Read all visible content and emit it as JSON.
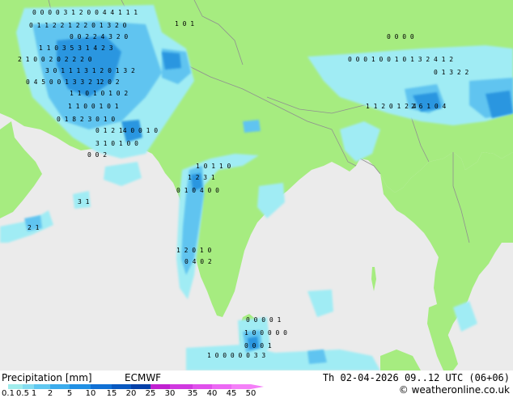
{
  "footer": {
    "title": "Precipitation [mm]",
    "model": "ECMWF",
    "valid_time": "Th 02-04-2026 09..12 UTC (06+06)",
    "credit": "© weatheronline.co.uk"
  },
  "legend": {
    "ticks": [
      "0.1",
      "0.5",
      "1",
      "2",
      "5",
      "10",
      "15",
      "20",
      "25",
      "30",
      "35",
      "40",
      "45",
      "50"
    ],
    "colors": [
      "#a0ecec",
      "#84dcf0",
      "#60c8f0",
      "#3cacec",
      "#2090e4",
      "#1070d4",
      "#0858c0",
      "#0440a8",
      "#c020d0",
      "#d038e0",
      "#e050ec",
      "#ec68f4",
      "#f480f8"
    ]
  },
  "map_colors": {
    "sea": "#ebebeb",
    "land": "#a6ec80",
    "borders": "#909090",
    "light_precip": "#a0ecf4",
    "moderate_precip": "#60c4f0",
    "heavy_precip": "#2a96e0"
  },
  "precip_labels": [
    "0 0 0 0 3 1 2 0 0 4 4 1 1 1",
    "0 1 1 2 2 1 2 2 0 1 3 2 0",
    "0 0 2 2 4 3 2 0",
    "1 1 0 3 5 3 1 4 2 3",
    "2 1 0 0 2 0 2 2 2 0",
    "3 0 1 1 1 3 1 2 0 1 3 2",
    "0 4 5 0 0 1 3 3 2 12 0 2",
    "1 1 0 1 0 1 0 2",
    "1 1 0 0 1 0 1",
    "0 1 8 2 3 0 1 0",
    "0 1 2 14 0 0 1 0",
    "3 1 0 1 0 0",
    "0 0 2",
    "0 0 0 1 0 0 1 0 1 3 2 4 1 2",
    "0 1 3 2 2",
    "1 1 2 0 1 2 4",
    "2 6 1 0 4",
    "1 0 1 1 0",
    "1 2 3 1",
    "0 1 0 4 0 0",
    "3 1",
    "2 1",
    "1 2 0 1 0",
    "0 4 0 2",
    "1 0 0 0 0 0 3 3",
    "0 0 0 0 1",
    "1 0 0 0 0 0",
    "0 0 0 1",
    "0 0 0 0",
    "1 0 1"
  ]
}
